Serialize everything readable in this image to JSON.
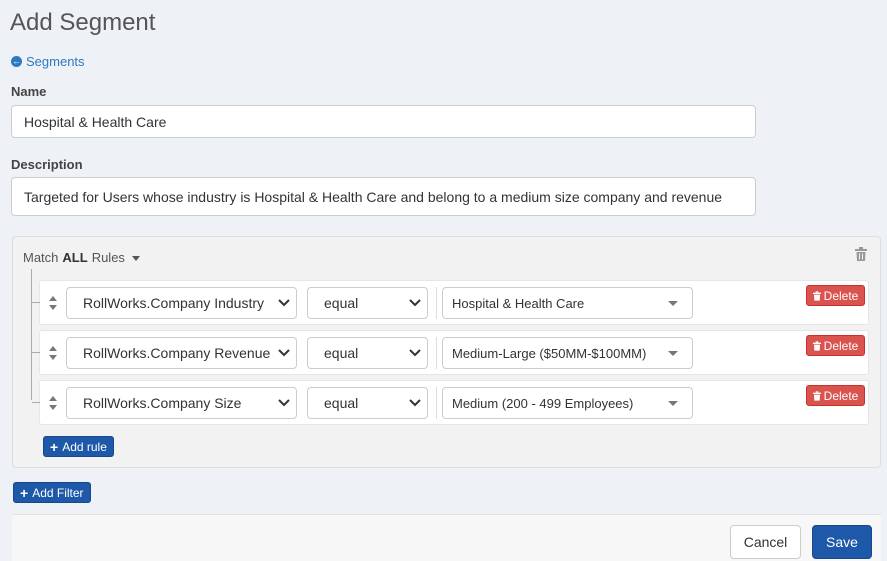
{
  "page": {
    "title": "Add Segment",
    "back_link": "Segments"
  },
  "form": {
    "name_label": "Name",
    "name_value": "Hospital & Health Care",
    "description_label": "Description",
    "description_value": "Targeted for Users whose industry is Hospital & Health Care and belong to a medium size company and revenue"
  },
  "rules": {
    "match_prefix": "Match",
    "match_mode": "ALL",
    "match_suffix": "Rules",
    "items": [
      {
        "field": "RollWorks.Company Industry",
        "operator": "equal",
        "value": "Hospital & Health Care",
        "delete_label": "Delete"
      },
      {
        "field": "RollWorks.Company Revenue",
        "operator": "equal",
        "value": "Medium-Large ($50MM-$100MM)",
        "delete_label": "Delete"
      },
      {
        "field": "RollWorks.Company Size",
        "operator": "equal",
        "value": "Medium (200 - 499 Employees)",
        "delete_label": "Delete"
      }
    ],
    "add_rule_label": "Add rule"
  },
  "add_filter_label": "Add Filter",
  "footer": {
    "cancel_label": "Cancel",
    "save_label": "Save"
  },
  "colors": {
    "primary": "#1e58a8",
    "danger": "#d9534f",
    "link": "#2f78c4",
    "background": "#eef1f6"
  },
  "icons": [
    "arrow-circle-left-icon",
    "caret-down-icon",
    "trash-icon",
    "sort-icon",
    "chevron-down-icon",
    "plus-icon"
  ]
}
